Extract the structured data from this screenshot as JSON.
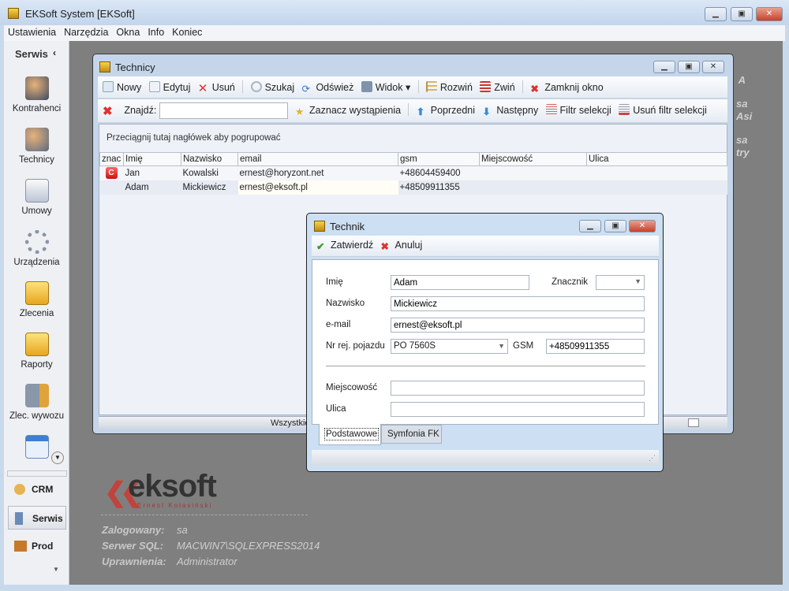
{
  "app": {
    "title": "EKSoft System [EKSoft]"
  },
  "menu": [
    "Ustawienia",
    "Narzędzia",
    "Okna",
    "Info",
    "Koniec"
  ],
  "sidebar": {
    "header": "Serwis",
    "collapse_icon": "‹",
    "items": [
      {
        "label": "Kontrahenci",
        "icon": "people-icon"
      },
      {
        "label": "Technicy",
        "icon": "technician-icon"
      },
      {
        "label": "Umowy",
        "icon": "contract-icon"
      },
      {
        "label": "Urządzenia",
        "icon": "gears-icon"
      },
      {
        "label": "Zlecenia",
        "icon": "order-icon"
      },
      {
        "label": "Raporty",
        "icon": "report-icon"
      },
      {
        "label": "Zlec. wywozu",
        "icon": "truck-icon"
      },
      {
        "label": "",
        "icon": "calendar-icon"
      }
    ],
    "modules": [
      {
        "label": "CRM"
      },
      {
        "label": "Serwis",
        "selected": true
      },
      {
        "label": "Prod"
      }
    ]
  },
  "technicy": {
    "title": "Technicy",
    "toolbar": [
      "Nowy",
      "Edytuj",
      "Usuń",
      "Szukaj",
      "Odśwież",
      "Widok",
      "Rozwiń",
      "Zwiń",
      "Zamknij okno"
    ],
    "find_label": "Znajdź:",
    "find_value": "",
    "find_toolbar": [
      "Zaznacz wystąpienia",
      "Poprzedni",
      "Następny",
      "Filtr selekcji",
      "Usuń filtr selekcji"
    ],
    "group_hint": "Przeciągnij tutaj nagłówek aby pogrupować",
    "columns": [
      "znac",
      "Imię",
      "Nazwisko",
      "email",
      "gsm",
      "Miejscowość",
      "Ulica"
    ],
    "rows": [
      {
        "marker": "C",
        "imie": "Jan",
        "nazwisko": "Kowalski",
        "email": "ernest@horyzont.net",
        "gsm": "+48604459400",
        "miejscowosc": "",
        "ulica": ""
      },
      {
        "marker": "",
        "imie": "Adam",
        "nazwisko": "Mickiewicz",
        "email": "ernest@eksoft.pl",
        "gsm": "+48509911355",
        "miejscowosc": "",
        "ulica": ""
      }
    ],
    "status": "Wszystkie"
  },
  "technik": {
    "title": "Technik",
    "confirm": "Zatwierdź",
    "cancel": "Anuluj",
    "fields": {
      "imie_label": "Imię",
      "imie": "Adam",
      "znacznik_label": "Znacznik",
      "znacznik": "",
      "nazwisko_label": "Nazwisko",
      "nazwisko": "Mickiewicz",
      "email_label": "e-mail",
      "email": "ernest@eksoft.pl",
      "nr_label": "Nr rej. pojazdu",
      "nr": "PO 7560S",
      "gsm_label": "GSM",
      "gsm": "+48509911355",
      "miejscowosc_label": "Miejscowość",
      "miejscowosc": "",
      "ulica_label": "Ulica",
      "ulica": ""
    },
    "tabs": [
      "Podstawowe",
      "Symfonia FK"
    ]
  },
  "info": {
    "logo": "eksoft",
    "logo_sub": "Ernest Kołasiński",
    "logged_label": "Zalogowany:",
    "logged": "sa",
    "server_label": "Serwer SQL:",
    "server": "MACWIN7\\SQLEXPRESS2014",
    "perm_label": "Uprawnienia:",
    "perm": "Administrator"
  },
  "background_fragments": [
    "A",
    "sa",
    "Asi",
    "sa",
    "try"
  ],
  "colors": {
    "accent": "#c7412a",
    "mdi": "#7f7f7f"
  }
}
